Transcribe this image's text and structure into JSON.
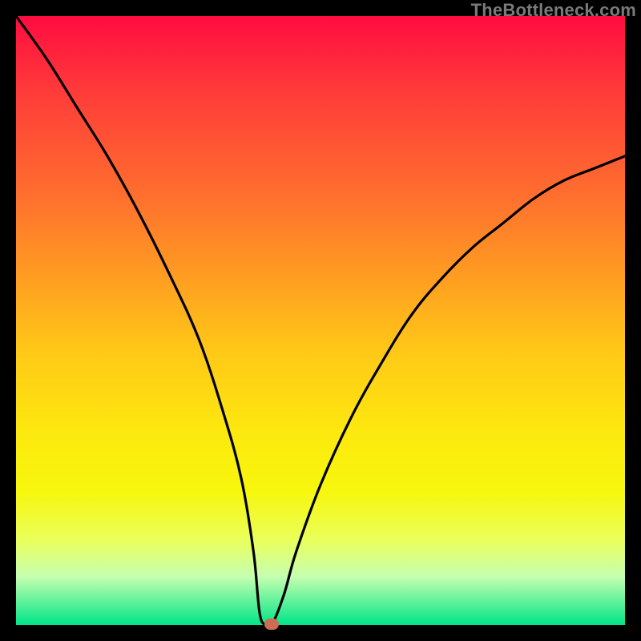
{
  "watermark": "TheBottleneck.com",
  "colors": {
    "frame": "#000000",
    "curve": "#000000",
    "marker": "#cf6a55",
    "gradient_top": "#ff0b40",
    "gradient_bottom": "#00e588"
  },
  "chart_data": {
    "type": "line",
    "title": "",
    "xlabel": "",
    "ylabel": "",
    "xlim": [
      0,
      100
    ],
    "ylim": [
      0,
      100
    ],
    "grid": false,
    "series": [
      {
        "name": "bottleneck-curve",
        "x": [
          0,
          5,
          10,
          15,
          20,
          25,
          30,
          34,
          37,
          39,
          40,
          41,
          42,
          44,
          46,
          50,
          55,
          60,
          65,
          70,
          75,
          80,
          85,
          90,
          95,
          100
        ],
        "values": [
          100,
          93,
          85,
          77,
          68,
          58,
          47,
          35,
          24,
          12,
          2,
          0,
          0,
          5,
          12,
          23,
          34,
          43,
          51,
          57,
          62,
          66,
          70,
          73,
          75,
          77
        ]
      }
    ],
    "annotations": [
      {
        "name": "optimal-marker",
        "x": 42,
        "y": 0
      }
    ]
  }
}
